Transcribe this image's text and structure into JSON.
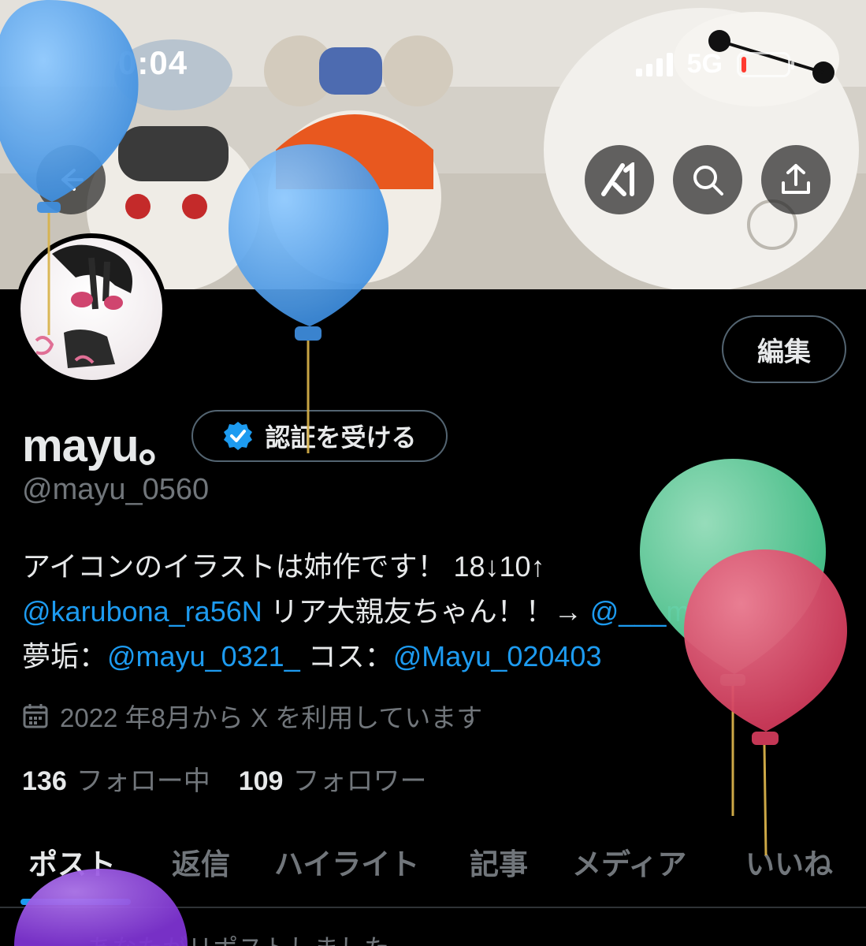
{
  "status_bar": {
    "time": "0:04",
    "network": "5G",
    "battery_level": 0.08
  },
  "banner": {
    "buttons": [
      {
        "name": "back",
        "icon": "back-arrow-icon"
      },
      {
        "name": "grok",
        "icon": "grok-icon"
      },
      {
        "name": "search",
        "icon": "search-icon"
      },
      {
        "name": "share",
        "icon": "share-icon"
      }
    ]
  },
  "profile": {
    "edit_label": "編集",
    "display_name": "mayu。",
    "verify_label": "認証を受ける",
    "handle": "@mayu_0560",
    "bio": {
      "line1": "アイコンのイラストは姉作です！ 18↓10↑",
      "line2_link": "@karubona_ra56N",
      "line2_text": " リア大親友ちゃん！！→ ",
      "line2_link2": "@___mAyk",
      "line3_prefix": "夢垢：",
      "line3_link1": "@mayu_0321_",
      "line3_mid": " コス：",
      "line3_link2": "@Mayu_020403"
    },
    "joined": "2022 年8月から X を利用しています",
    "following_count": "136",
    "following_label": "フォロー中",
    "followers_count": "109",
    "followers_label": "フォロワー"
  },
  "tabs": [
    {
      "label": "ポスト",
      "active": true
    },
    {
      "label": "返信",
      "active": false
    },
    {
      "label": "ハイライト",
      "active": false
    },
    {
      "label": "記事",
      "active": false
    },
    {
      "label": "メディア",
      "active": false
    },
    {
      "label": "いいね",
      "active": false
    }
  ],
  "feed": {
    "repost_note": "あなたがリポストしました"
  },
  "colors": {
    "accent": "#1d9bf0",
    "background": "#000000",
    "muted": "#71767b",
    "balloon_blue": "#4a9fe8",
    "balloon_green": "#5ed39f",
    "balloon_red": "#d94a66",
    "balloon_purple": "#8b3fd9"
  }
}
